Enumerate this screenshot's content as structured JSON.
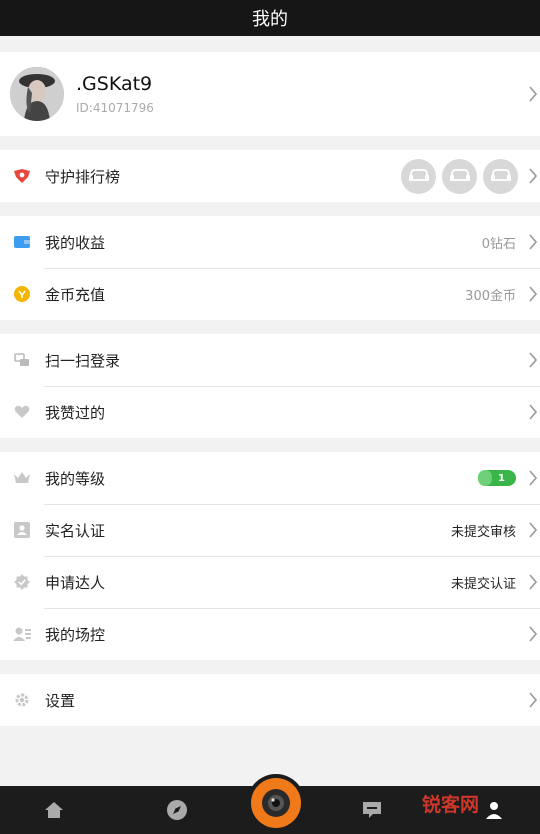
{
  "header": {
    "title": "我的"
  },
  "profile": {
    "username": ".GSKat9",
    "user_id": "ID:41071796"
  },
  "guard": {
    "label": "守护排行榜"
  },
  "wallet": [
    {
      "label": "我的收益",
      "value": "0钻石",
      "icon": "wallet-icon"
    },
    {
      "label": "金币充值",
      "value": "300金币",
      "icon": "coin-icon"
    }
  ],
  "actions": [
    {
      "label": "扫一扫登录",
      "icon": "scan-icon"
    },
    {
      "label": "我赞过的",
      "icon": "heart-icon"
    }
  ],
  "account": {
    "level": {
      "label": "我的等级",
      "badge": "1"
    },
    "realname": {
      "label": "实名认证",
      "value": "未提交审核"
    },
    "talent": {
      "label": "申请达人",
      "value": "未提交认证"
    },
    "moderator": {
      "label": "我的场控"
    }
  },
  "settings": {
    "label": "设置"
  },
  "watermark": {
    "text": "锐客网"
  },
  "colors": {
    "accent": "#f07a1a",
    "level_green": "#3ab54a",
    "header_bg": "#161616"
  }
}
